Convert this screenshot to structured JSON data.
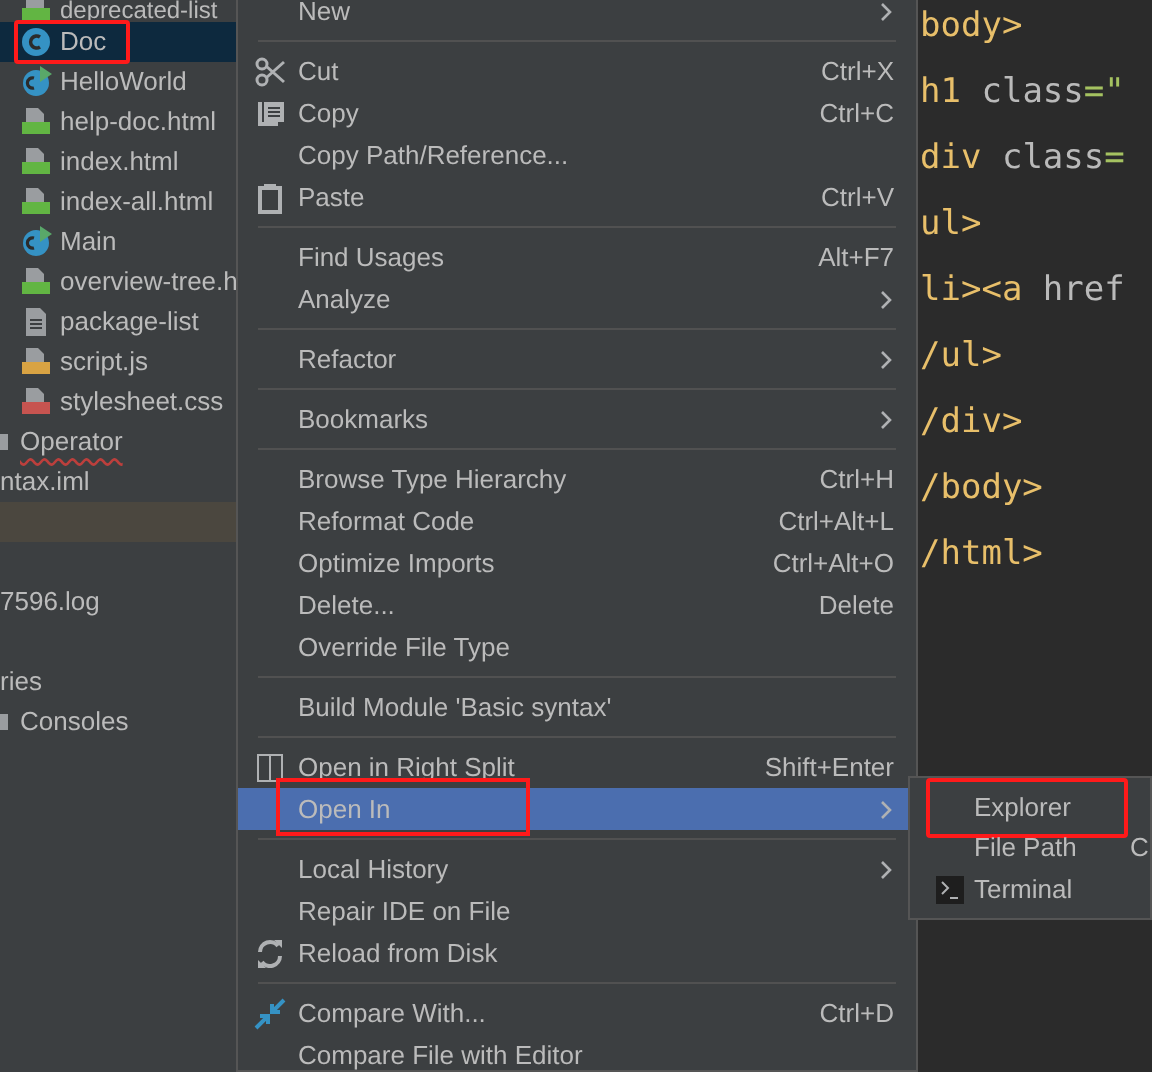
{
  "project_tree": [
    {
      "label": "deprecated-list",
      "kind": "html",
      "selected": false
    },
    {
      "label": "Doc",
      "kind": "class",
      "selected": true,
      "annotated": true
    },
    {
      "label": "HelloWorld",
      "kind": "runnable",
      "selected": false
    },
    {
      "label": "help-doc.html",
      "kind": "html",
      "selected": false
    },
    {
      "label": "index.html",
      "kind": "html",
      "selected": false
    },
    {
      "label": "index-all.html",
      "kind": "html",
      "selected": false
    },
    {
      "label": "Main",
      "kind": "runnable",
      "selected": false
    },
    {
      "label": "overview-tree.h",
      "kind": "html",
      "selected": false
    },
    {
      "label": "package-list",
      "kind": "text",
      "selected": false
    },
    {
      "label": "script.js",
      "kind": "js",
      "selected": false
    },
    {
      "label": "stylesheet.css",
      "kind": "css",
      "selected": false
    },
    {
      "label": "Operator",
      "kind": "package",
      "selected": false,
      "error": true
    },
    {
      "label": "ntax.iml",
      "kind": "plain",
      "selected": false
    },
    {
      "kind": "spacer",
      "highlighted": true
    },
    {
      "kind": "spacer"
    },
    {
      "label": "7596.log",
      "kind": "plain",
      "selected": false
    },
    {
      "kind": "spacer"
    },
    {
      "label": "ries",
      "kind": "plain",
      "selected": false
    },
    {
      "label": "Consoles",
      "kind": "package",
      "selected": false
    }
  ],
  "context_menu": [
    {
      "kind": "item",
      "label": "New",
      "submenu": true,
      "selected": false
    },
    {
      "kind": "separator"
    },
    {
      "kind": "item",
      "label": "Cut",
      "shortcut": "Ctrl+X",
      "selected": false
    },
    {
      "kind": "item",
      "label": "Copy",
      "shortcut": "Ctrl+C",
      "selected": false
    },
    {
      "kind": "item",
      "label": "Copy Path/Reference...",
      "selected": false
    },
    {
      "kind": "item",
      "label": "Paste",
      "shortcut": "Ctrl+V",
      "selected": false
    },
    {
      "kind": "separator"
    },
    {
      "kind": "item",
      "label": "Find Usages",
      "shortcut": "Alt+F7",
      "selected": false
    },
    {
      "kind": "item",
      "label": "Analyze",
      "submenu": true,
      "selected": false
    },
    {
      "kind": "separator"
    },
    {
      "kind": "item",
      "label": "Refactor",
      "submenu": true,
      "selected": false
    },
    {
      "kind": "separator"
    },
    {
      "kind": "item",
      "label": "Bookmarks",
      "submenu": true,
      "selected": false
    },
    {
      "kind": "separator"
    },
    {
      "kind": "item",
      "label": "Browse Type Hierarchy",
      "shortcut": "Ctrl+H",
      "selected": false
    },
    {
      "kind": "item",
      "label": "Reformat Code",
      "shortcut": "Ctrl+Alt+L",
      "selected": false
    },
    {
      "kind": "item",
      "label": "Optimize Imports",
      "shortcut": "Ctrl+Alt+O",
      "selected": false
    },
    {
      "kind": "item",
      "label": "Delete...",
      "shortcut": "Delete",
      "selected": false
    },
    {
      "kind": "item",
      "label": "Override File Type",
      "selected": false
    },
    {
      "kind": "separator"
    },
    {
      "kind": "item",
      "label": "Build Module 'Basic syntax'",
      "selected": false
    },
    {
      "kind": "separator"
    },
    {
      "kind": "item",
      "label": "Open in Right Split",
      "shortcut": "Shift+Enter",
      "selected": false
    },
    {
      "kind": "item",
      "label": "Open In",
      "submenu": true,
      "selected": true,
      "annotated": true
    },
    {
      "kind": "separator"
    },
    {
      "kind": "item",
      "label": "Local History",
      "submenu": true,
      "selected": false
    },
    {
      "kind": "item",
      "label": "Repair IDE on File",
      "selected": false
    },
    {
      "kind": "item",
      "label": "Reload from Disk",
      "selected": false
    },
    {
      "kind": "separator"
    },
    {
      "kind": "item",
      "label": "Compare With...",
      "shortcut": "Ctrl+D",
      "selected": false
    },
    {
      "kind": "item",
      "label": "Compare File with Editor",
      "selected": false
    }
  ],
  "submenu": [
    {
      "label": "Explorer",
      "annotated": true
    },
    {
      "label": "File Path",
      "shortcut": "C"
    },
    {
      "label": "Terminal"
    }
  ],
  "editor_lines": [
    [
      {
        "text": "body>",
        "color": "#e8bf6a"
      }
    ],
    [
      {
        "text": "h1 ",
        "color": "#e8bf6a"
      },
      {
        "text": "class",
        "color": "#bababa"
      },
      {
        "text": "=\"",
        "color": "#a5c261"
      }
    ],
    [
      {
        "text": "div ",
        "color": "#e8bf6a"
      },
      {
        "text": "class",
        "color": "#bababa"
      },
      {
        "text": "=",
        "color": "#a5c261"
      }
    ],
    [
      {
        "text": "ul>",
        "color": "#e8bf6a"
      }
    ],
    [
      {
        "text": "li><a ",
        "color": "#e8bf6a"
      },
      {
        "text": "href",
        "color": "#bababa"
      }
    ],
    [
      {
        "text": "/ul>",
        "color": "#e8bf6a"
      }
    ],
    [
      {
        "text": "/div>",
        "color": "#e8bf6a"
      }
    ],
    [
      {
        "text": "/body>",
        "color": "#e8bf6a"
      }
    ],
    [
      {
        "text": "/html>",
        "color": "#e8bf6a"
      }
    ]
  ]
}
